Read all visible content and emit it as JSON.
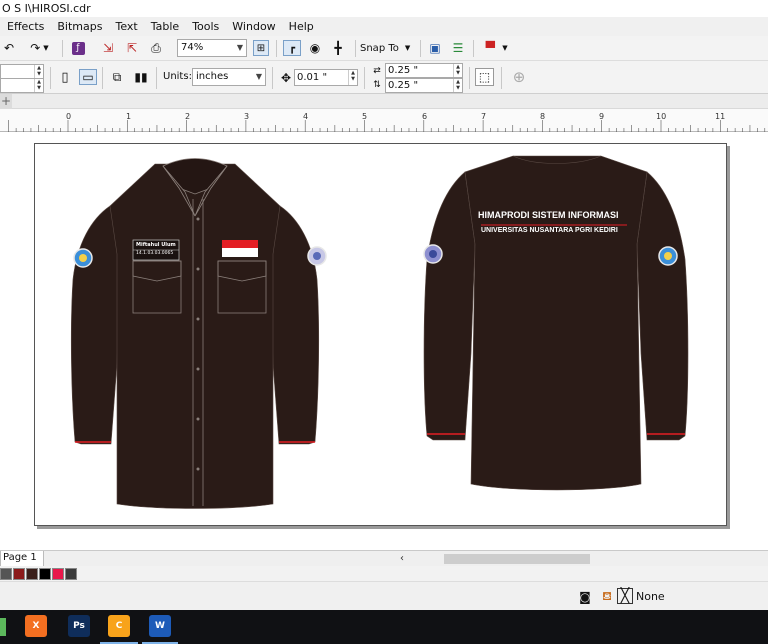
{
  "window": {
    "title": "O S I\\HIROSI.cdr"
  },
  "menu": [
    {
      "label": "Effects",
      "key": "c"
    },
    {
      "label": "Bitmaps",
      "key": "B"
    },
    {
      "label": "Text",
      "key": "x"
    },
    {
      "label": "Table",
      "key": "T"
    },
    {
      "label": "Tools",
      "key": "o"
    },
    {
      "label": "Window",
      "key": "W"
    },
    {
      "label": "Help",
      "key": "H"
    }
  ],
  "toolbar": {
    "zoom_value": "74%",
    "snap_label": "Snap To"
  },
  "property_bar": {
    "units_label": "Units:",
    "units_value": "inches",
    "nudge_value": "0.01 \"",
    "dup_x": "0.25 \"",
    "dup_y": "0.25 \""
  },
  "ruler": {
    "labels": [
      "0",
      "1",
      "2",
      "3",
      "4",
      "5",
      "6",
      "7",
      "8",
      "9",
      "10",
      "11"
    ]
  },
  "design": {
    "front": {
      "name_tag_line1": "Miftahul Ulum",
      "name_tag_line2": "14.1.03.03.0065"
    },
    "back": {
      "line1": "HIMAPRODI SISTEM INFORMASI",
      "line2": "UNIVERSITAS NUSANTARA PGRI KEDIRI"
    },
    "colors": {
      "shirt": "#2a1b17",
      "red": "#e31e24",
      "outline": "#8a7f7a"
    }
  },
  "bottom": {
    "page_tab": "Page 1"
  },
  "palette": [
    "#555555",
    "#8b1a1a",
    "#3a1f1a",
    "#000000",
    "#e8174a",
    "#3b3b3b"
  ],
  "status": {
    "fill_label": "None"
  },
  "taskbar": [
    {
      "name": "xampp",
      "label": "X",
      "color": "#f36f21"
    },
    {
      "name": "photoshop",
      "label": "Ps",
      "color": "#0f2d5a"
    },
    {
      "name": "coreldraw",
      "label": "C",
      "color": "#f8a31b"
    },
    {
      "name": "word",
      "label": "W",
      "color": "#1d5bb8"
    }
  ]
}
